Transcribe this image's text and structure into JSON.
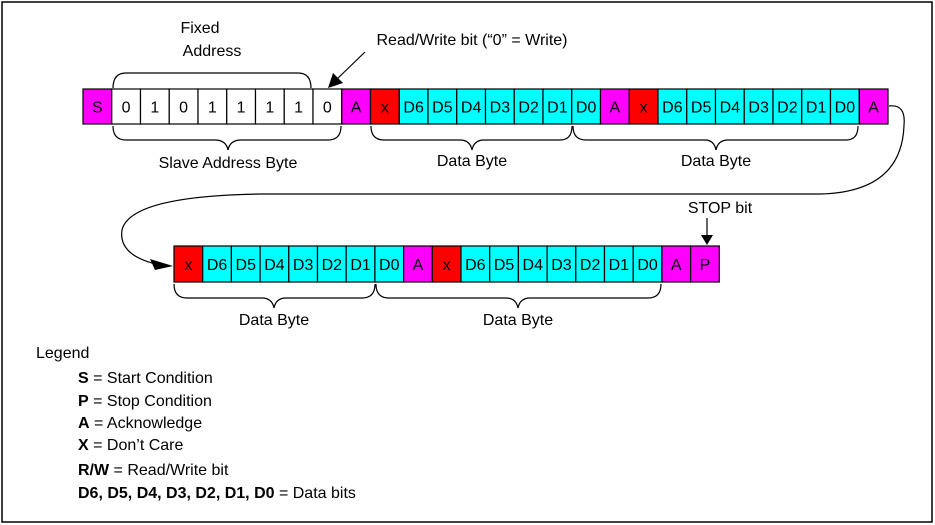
{
  "colors": {
    "start_stop_ack": "#ff00ff",
    "dont_care": "#ff0000",
    "data": "#00ffff",
    "address": "#ffffff"
  },
  "labels": {
    "fixed_address_line1": "Fixed",
    "fixed_address_line2": "Address",
    "rw_bit": "Read/Write bit (“0” = Write)",
    "slave_address_byte": "Slave Address Byte",
    "data_byte": "Data Byte",
    "stop_bit": "STOP bit"
  },
  "row1": [
    {
      "t": "S",
      "k": "s"
    },
    {
      "t": "0",
      "k": "w"
    },
    {
      "t": "1",
      "k": "w"
    },
    {
      "t": "0",
      "k": "w"
    },
    {
      "t": "1",
      "k": "w"
    },
    {
      "t": "1",
      "k": "w"
    },
    {
      "t": "1",
      "k": "w"
    },
    {
      "t": "1",
      "k": "w"
    },
    {
      "t": "0",
      "k": "w"
    },
    {
      "t": "A",
      "k": "s"
    },
    {
      "t": "x",
      "k": "x"
    },
    {
      "t": "D6",
      "k": "d"
    },
    {
      "t": "D5",
      "k": "d"
    },
    {
      "t": "D4",
      "k": "d"
    },
    {
      "t": "D3",
      "k": "d"
    },
    {
      "t": "D2",
      "k": "d"
    },
    {
      "t": "D1",
      "k": "d"
    },
    {
      "t": "D0",
      "k": "d"
    },
    {
      "t": "A",
      "k": "s"
    },
    {
      "t": "x",
      "k": "x"
    },
    {
      "t": "D6",
      "k": "d"
    },
    {
      "t": "D5",
      "k": "d"
    },
    {
      "t": "D4",
      "k": "d"
    },
    {
      "t": "D3",
      "k": "d"
    },
    {
      "t": "D2",
      "k": "d"
    },
    {
      "t": "D1",
      "k": "d"
    },
    {
      "t": "D0",
      "k": "d"
    },
    {
      "t": "A",
      "k": "s"
    }
  ],
  "row2": [
    {
      "t": "x",
      "k": "x"
    },
    {
      "t": "D6",
      "k": "d"
    },
    {
      "t": "D5",
      "k": "d"
    },
    {
      "t": "D4",
      "k": "d"
    },
    {
      "t": "D3",
      "k": "d"
    },
    {
      "t": "D2",
      "k": "d"
    },
    {
      "t": "D1",
      "k": "d"
    },
    {
      "t": "D0",
      "k": "d"
    },
    {
      "t": "A",
      "k": "s"
    },
    {
      "t": "x",
      "k": "x"
    },
    {
      "t": "D6",
      "k": "d"
    },
    {
      "t": "D5",
      "k": "d"
    },
    {
      "t": "D4",
      "k": "d"
    },
    {
      "t": "D3",
      "k": "d"
    },
    {
      "t": "D2",
      "k": "d"
    },
    {
      "t": "D1",
      "k": "d"
    },
    {
      "t": "D0",
      "k": "d"
    },
    {
      "t": "A",
      "k": "s"
    },
    {
      "t": "P",
      "k": "s"
    }
  ],
  "legend": {
    "title": "Legend",
    "items": [
      {
        "key": "S",
        "desc": " = Start Condition"
      },
      {
        "key": "P",
        "desc": " = Stop Condition"
      },
      {
        "key": "A",
        "desc": " = Acknowledge"
      },
      {
        "key": "X",
        "desc": " = Don’t Care"
      },
      {
        "key": "R/W",
        "desc": " = Read/Write bit"
      },
      {
        "key": "D6, D5, D4, D3, D2, D1, D0",
        "desc": " = Data bits"
      }
    ]
  }
}
